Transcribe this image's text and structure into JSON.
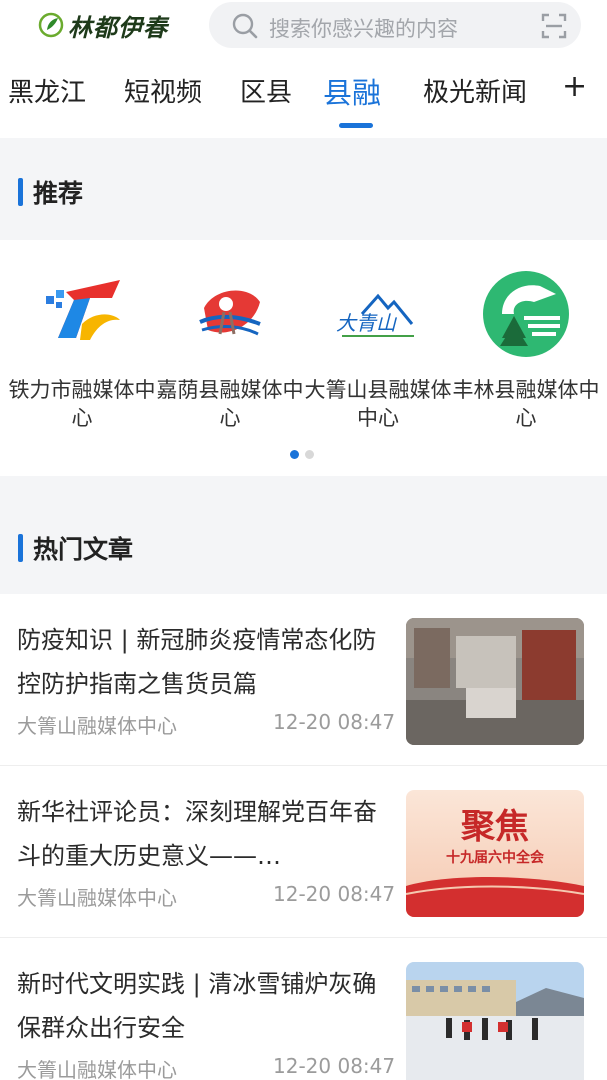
{
  "header": {
    "logo_text": "林都伊春",
    "search_placeholder": "搜索你感兴趣的内容"
  },
  "tabs": [
    {
      "label": "黑龙江",
      "active": false
    },
    {
      "label": "短视频",
      "active": false
    },
    {
      "label": "区县",
      "active": false
    },
    {
      "label": "县融",
      "active": true
    },
    {
      "label": "极光新闻",
      "active": false
    }
  ],
  "add_tab_label": "+",
  "recommend": {
    "title": "推荐",
    "items": [
      {
        "name": "铁力市融媒体中心",
        "logo": "tieli-logo"
      },
      {
        "name": "嘉荫县融媒体中心",
        "logo": "jiayin-logo"
      },
      {
        "name": "大箐山县融媒体中心",
        "logo": "daqingshan-logo",
        "logo_text": "大青山"
      },
      {
        "name": "丰林县融媒体中心",
        "logo": "fenglin-logo"
      }
    ],
    "page_count": 2,
    "current_page": 1
  },
  "hot": {
    "title": "热门文章",
    "articles": [
      {
        "title": "防疫知识 | 新冠肺炎疫情常态化防控防护指南之售货员篇",
        "source": "大箐山融媒体中心",
        "time": "12-20 08:47",
        "thumb": "store-photo"
      },
      {
        "title": "新华社评论员：深刻理解党百年奋斗的重大历史意义——…",
        "source": "大箐山融媒体中心",
        "time": "12-20 08:47",
        "thumb": "plenum-banner",
        "thumb_text": "聚焦",
        "thumb_subtext": "十九届六中全会"
      },
      {
        "title": "新时代文明实践 | 清冰雪铺炉灰确保群众出行安全",
        "source": "大箐山融媒体中心",
        "time": "12-20 08:47",
        "thumb": "snow-clearing-photo"
      }
    ]
  },
  "colors": {
    "accent": "#1a73d9",
    "band": "#f4f5f7",
    "muted": "#9b9b9b"
  }
}
